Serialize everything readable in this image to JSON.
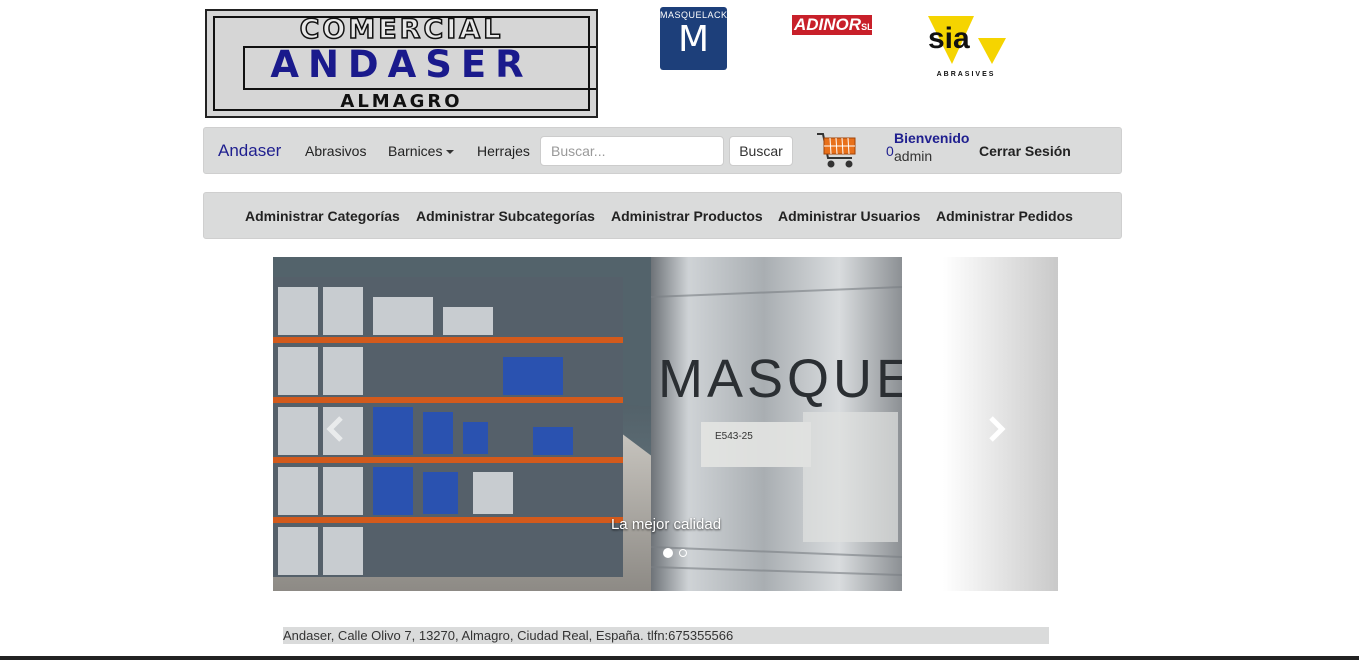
{
  "header": {
    "logo_main": {
      "line1": "COMERCIAL",
      "line2": "ANDASER",
      "line3": "ALMAGRO"
    },
    "logo_masquelack": {
      "top": "MASQUELACK",
      "letter": "M"
    },
    "logo_adinor": {
      "name": "ADINOR",
      "suffix": "SL"
    },
    "logo_sia": {
      "name": "sia",
      "sub": "ABRASIVES"
    }
  },
  "navbar": {
    "brand": "Andaser",
    "links": [
      "Abrasivos",
      "Barnices",
      "Herrajes"
    ],
    "search_placeholder": "Buscar...",
    "search_button": "Buscar",
    "cart_icon": "shopping-cart-icon",
    "cart_count": "0",
    "welcome": "Bienvenido",
    "username": "admin",
    "logout": "Cerrar Sesión"
  },
  "admin_nav": {
    "links": [
      "Administrar Categorías",
      "Administrar Subcategorías",
      "Administrar Productos",
      "Administrar Usuarios",
      "Administrar Pedidos"
    ]
  },
  "carousel": {
    "caption": "La mejor calidad",
    "drum_text": "MASQUE",
    "drum_label": "E543-25",
    "active_index": 0,
    "total": 2
  },
  "footer": {
    "text": "Andaser, Calle Olivo 7, 13270, Almagro, Ciudad Real, España. tlfn:675355566"
  },
  "colors": {
    "brand_blue": "#1f1f8f",
    "navbar_bg": "#dadbdb",
    "adinor_red": "#c8202a",
    "masquelack_blue": "#1d3f7a",
    "sia_yellow": "#f5d400"
  }
}
